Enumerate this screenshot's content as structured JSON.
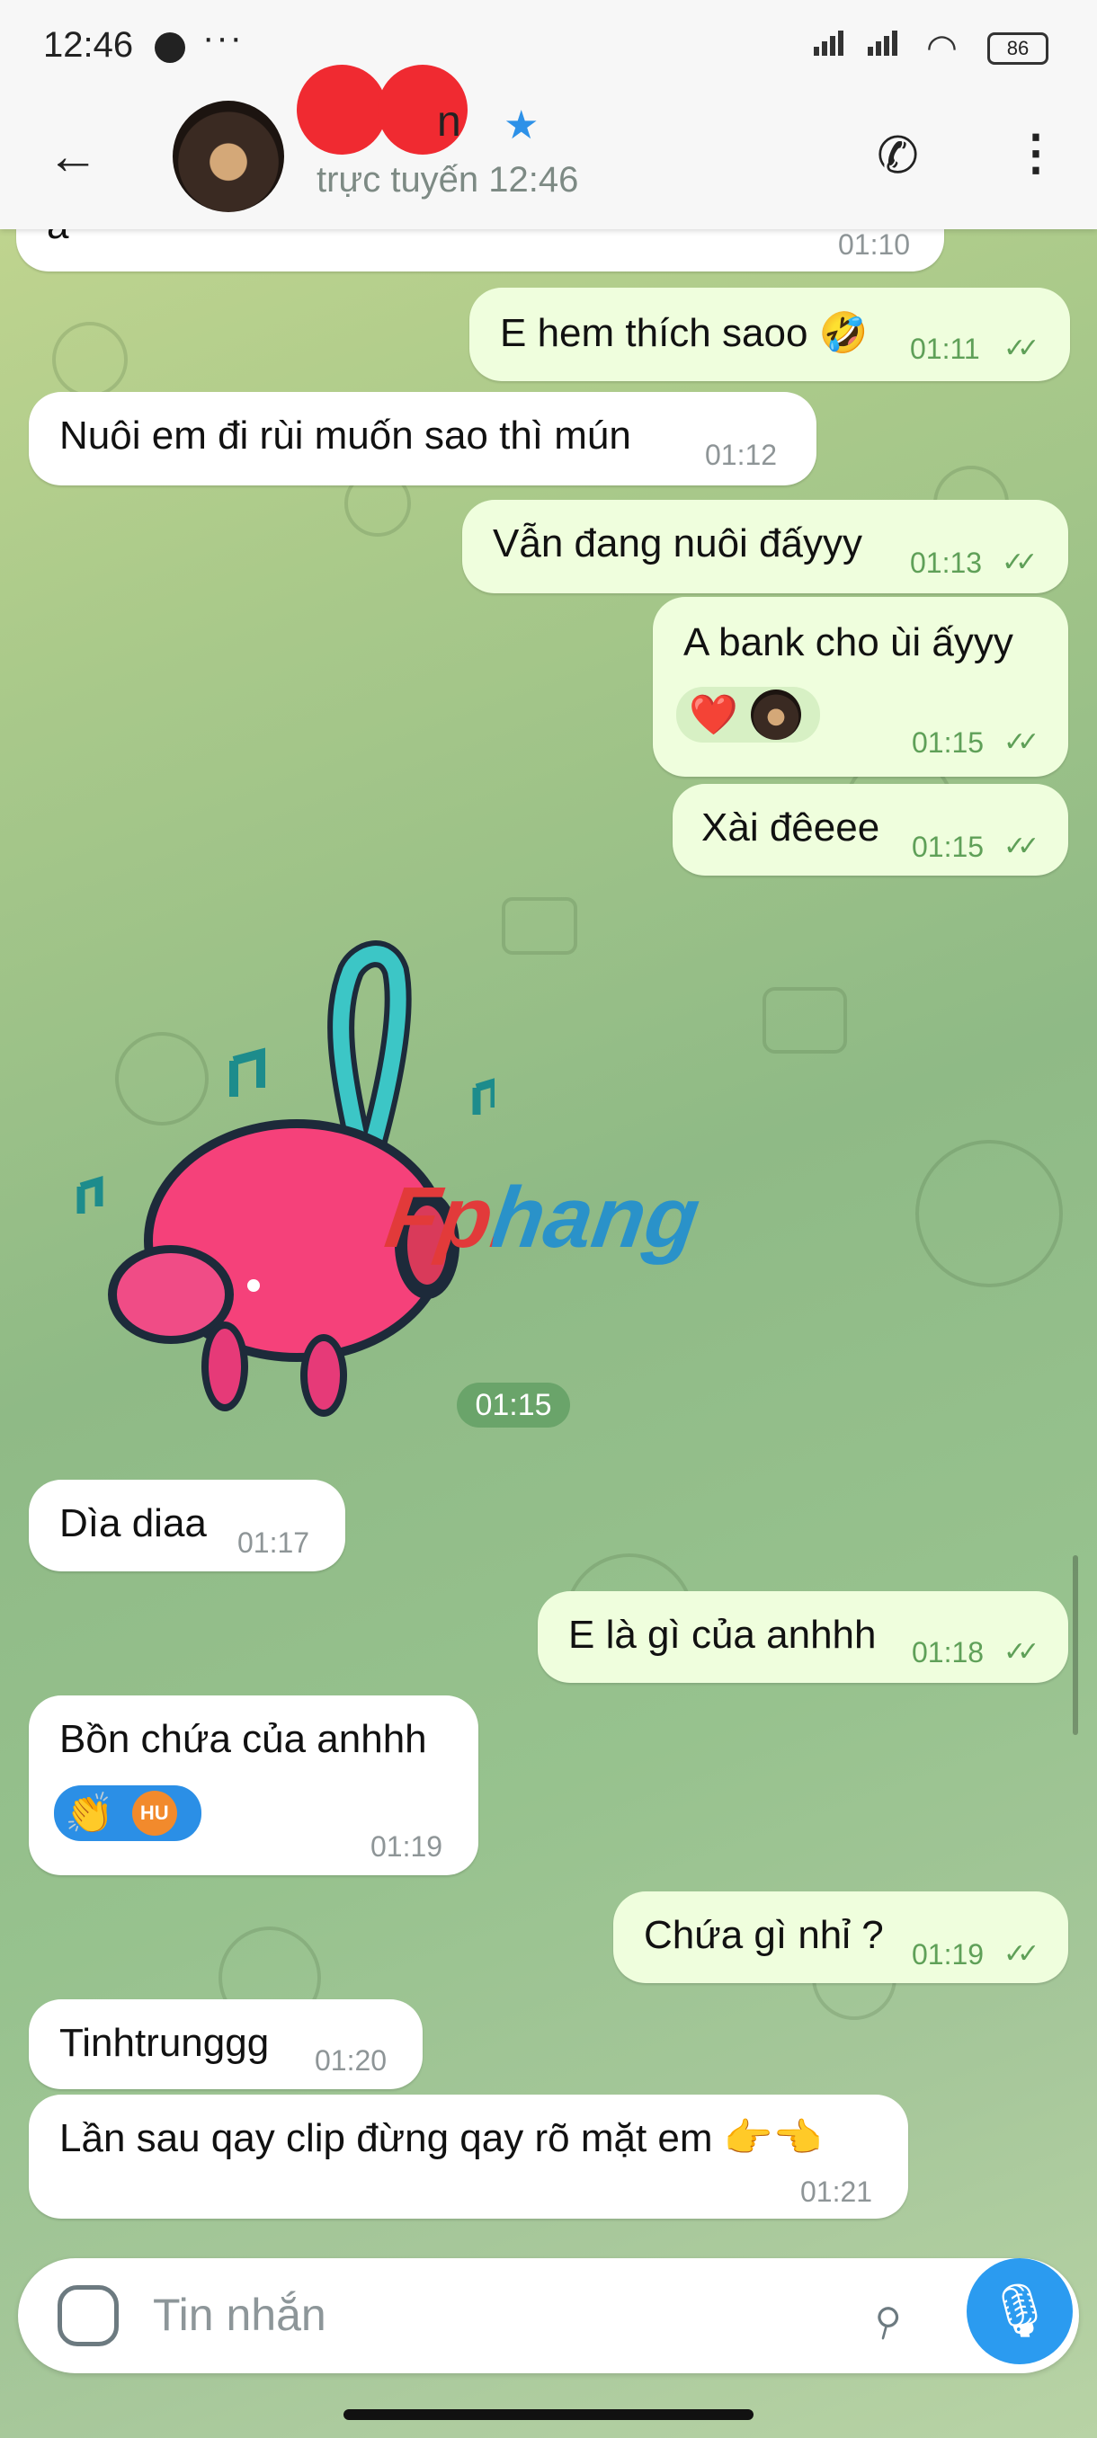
{
  "status_bar": {
    "time": "12:46",
    "dots": "···",
    "battery": "86"
  },
  "header": {
    "name_visible": "n",
    "presence": "trực tuyến 12:46"
  },
  "messages": [
    {
      "side": "in",
      "text": "a",
      "time": "01:10"
    },
    {
      "side": "out",
      "text": "E hem thích saoo 🤣",
      "time": "01:11"
    },
    {
      "side": "in",
      "text": "Nuôi em đi rùi muốn sao thì mún",
      "time": "01:12"
    },
    {
      "side": "out",
      "text": "Vẫn đang nuôi đấyyy",
      "time": "01:13"
    },
    {
      "side": "out",
      "text": "A bank cho ùi ấyyy",
      "time": "01:15",
      "reaction": "❤️"
    },
    {
      "side": "out",
      "text": "Xài đêeee",
      "time": "01:15"
    },
    {
      "side": "sticker",
      "time": "01:15"
    },
    {
      "side": "in",
      "text": "Dìa diaa",
      "time": "01:17"
    },
    {
      "side": "out",
      "text": "E là gì của anhhh",
      "time": "01:18"
    },
    {
      "side": "in",
      "text": "Bồn chứa của anhhh",
      "time": "01:19",
      "reaction": "👏",
      "reaction_badge": "HU"
    },
    {
      "side": "out",
      "text": "Chứa gì nhỉ ?",
      "time": "01:19"
    },
    {
      "side": "in",
      "text": "Tinhtrunggg",
      "time": "01:20"
    },
    {
      "side": "in",
      "text": "Lần sau qay clip đừng qay rõ mặt em 👉👈",
      "time": "01:21"
    }
  ],
  "watermark": "Fphang",
  "composer": {
    "placeholder": "Tin nhắn"
  }
}
